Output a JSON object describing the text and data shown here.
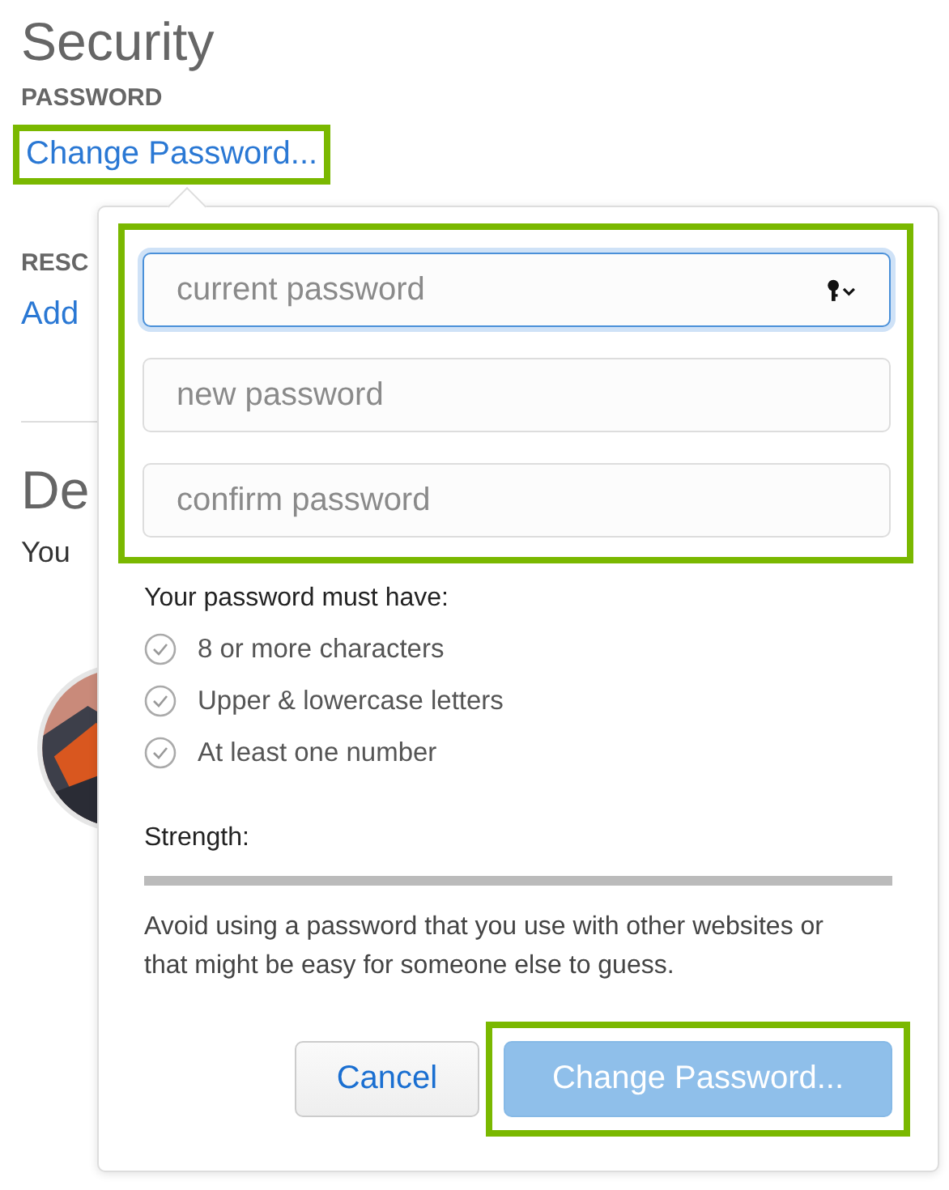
{
  "page": {
    "title": "Security",
    "password_heading": "PASSWORD",
    "change_link": "Change Password...",
    "rescue_heading": "RESC",
    "add_link": "Add",
    "devices_title": "De",
    "devices_text": "You"
  },
  "popover": {
    "fields": [
      {
        "placeholder": "current password",
        "focused": true,
        "key_icon": true
      },
      {
        "placeholder": "new password",
        "focused": false,
        "key_icon": false
      },
      {
        "placeholder": "confirm password",
        "focused": false,
        "key_icon": false
      }
    ],
    "rules_heading": "Your password must have:",
    "rules": [
      {
        "label": "8 or more characters",
        "met": false
      },
      {
        "label": "Upper & lowercase letters",
        "met": false
      },
      {
        "label": "At least one number",
        "met": false
      }
    ],
    "strength_label": "Strength:",
    "strength": {
      "level": 0
    },
    "advice": "Avoid using a password that you use with other websites or that might be easy for someone else to guess.",
    "buttons": [
      {
        "label": "Cancel",
        "kind": "secondary",
        "disabled": false
      },
      {
        "label": "Change Password...",
        "kind": "primary",
        "disabled": true
      }
    ]
  }
}
